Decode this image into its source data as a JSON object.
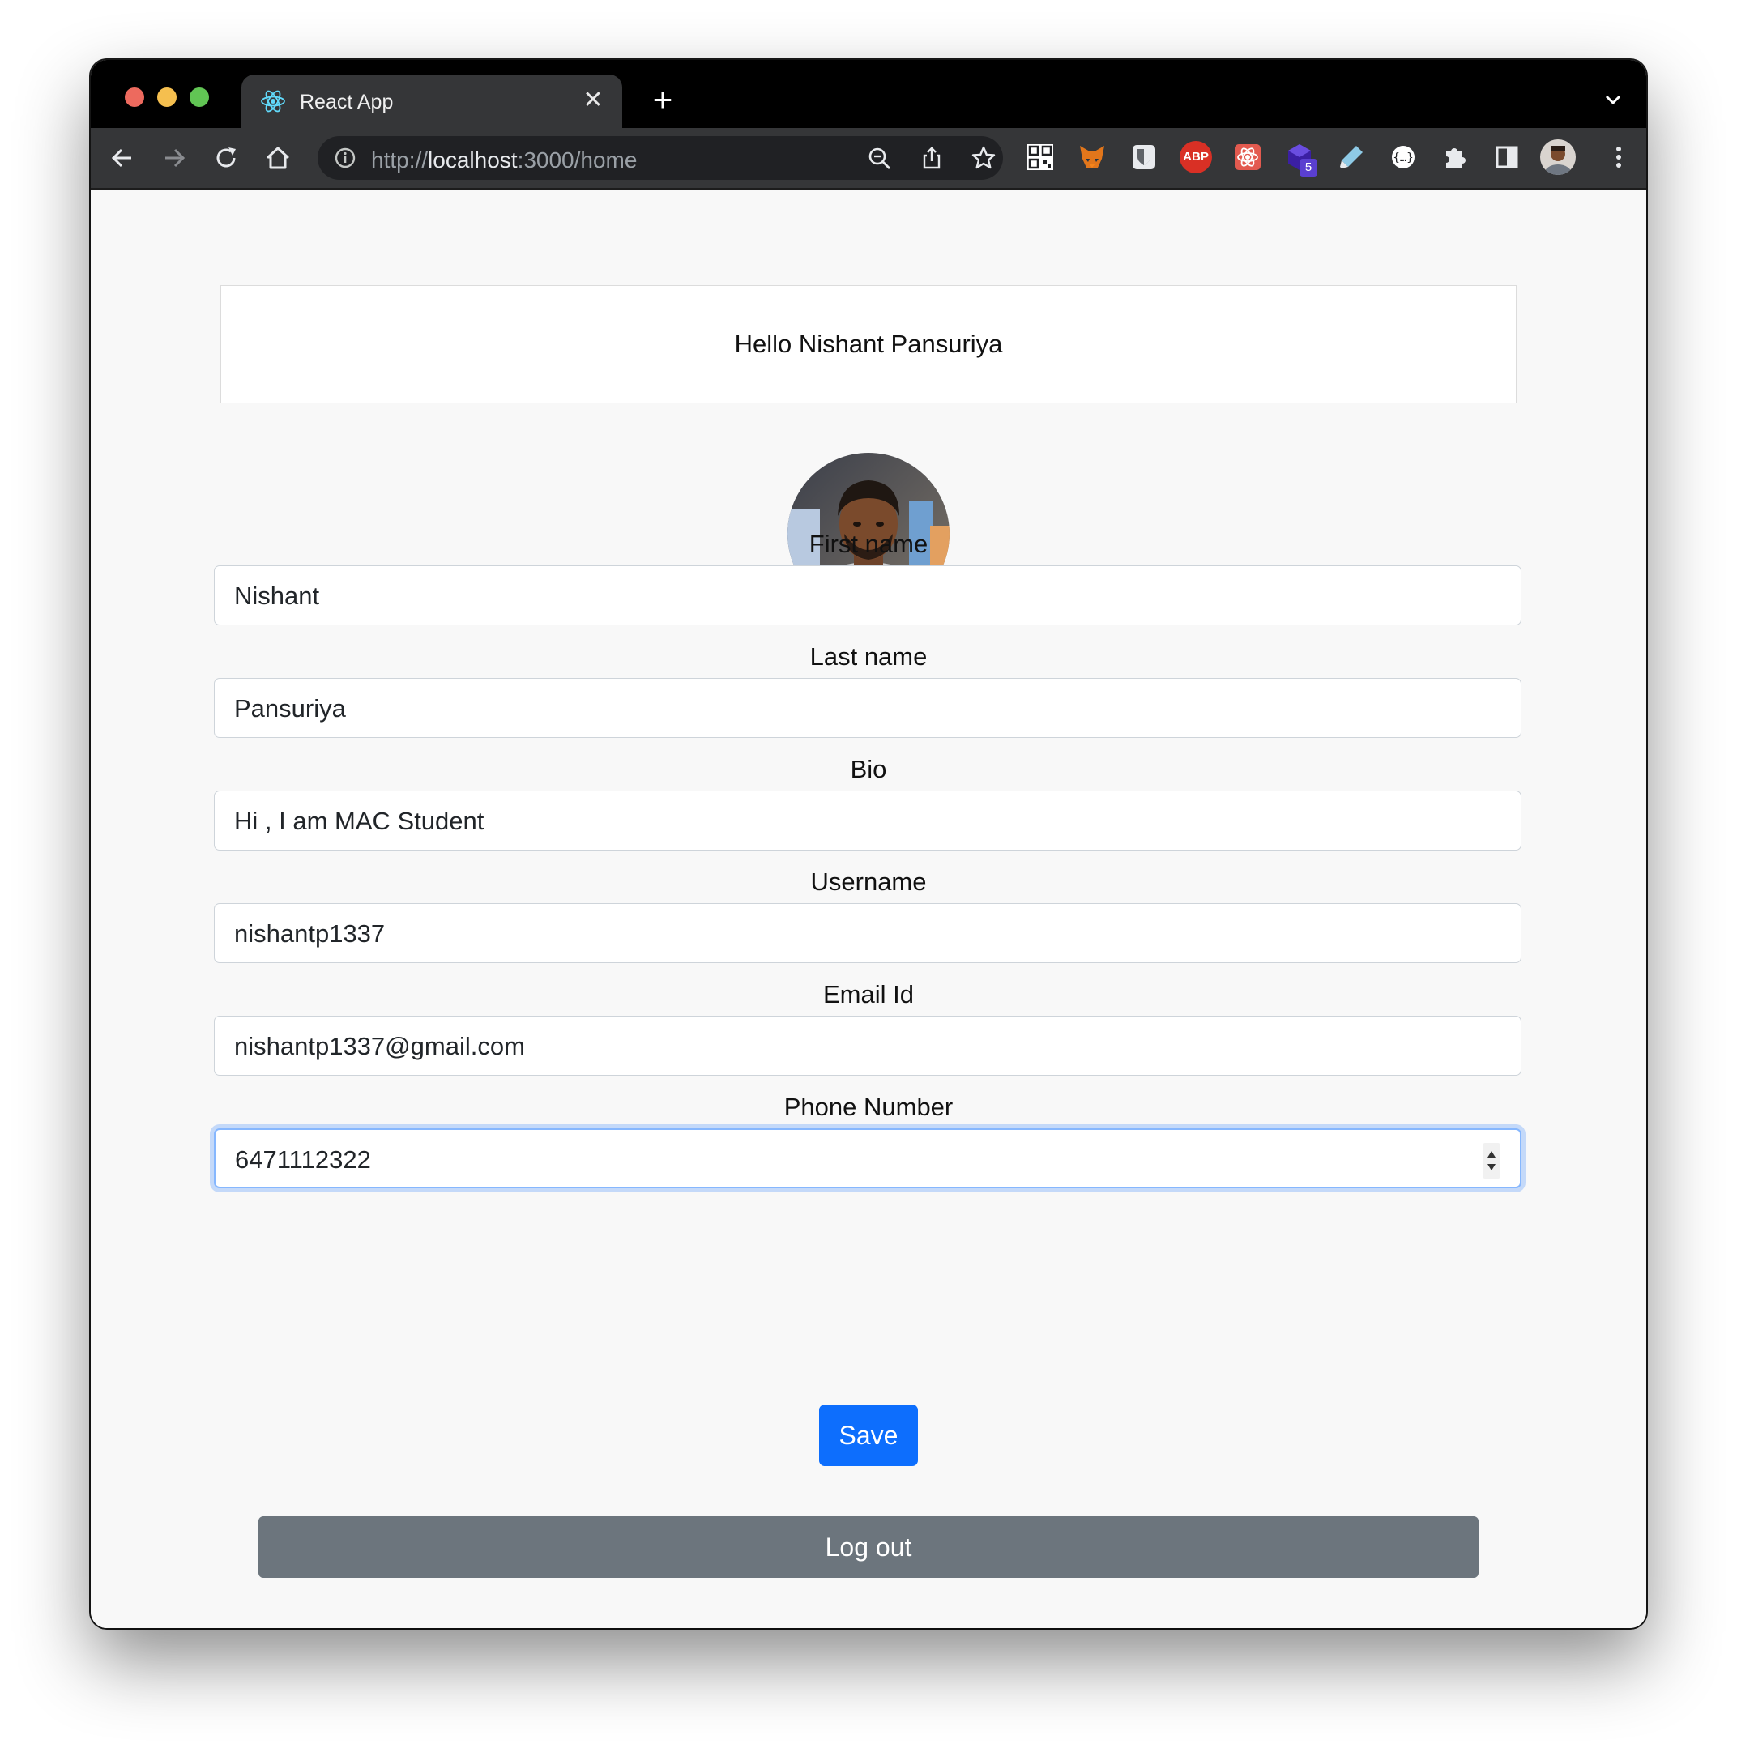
{
  "browser": {
    "tab_title": "React App",
    "url_scheme": "http://",
    "url_host": "localhost",
    "url_rest": ":3000/home",
    "extension_badge": "5",
    "extension_abp": "ABP"
  },
  "header": {
    "greeting": "Hello Nishant Pansuriya"
  },
  "form": {
    "first_name_label": "First name",
    "first_name_value": "Nishant",
    "last_name_label": "Last name",
    "last_name_value": "Pansuriya",
    "bio_label": "Bio",
    "bio_value": "Hi , I am MAC Student",
    "username_label": "Username",
    "username_value": "nishantp1337",
    "email_label": "Email Id",
    "email_value": "nishantp1337@gmail.com",
    "phone_label": "Phone Number",
    "phone_value": "6471112322",
    "save_label": "Save"
  },
  "actions": {
    "logout_label": "Log out"
  },
  "colors": {
    "primary": "#0d6efd",
    "secondary": "#6c757d",
    "focus_ring": "#86b7fe"
  }
}
